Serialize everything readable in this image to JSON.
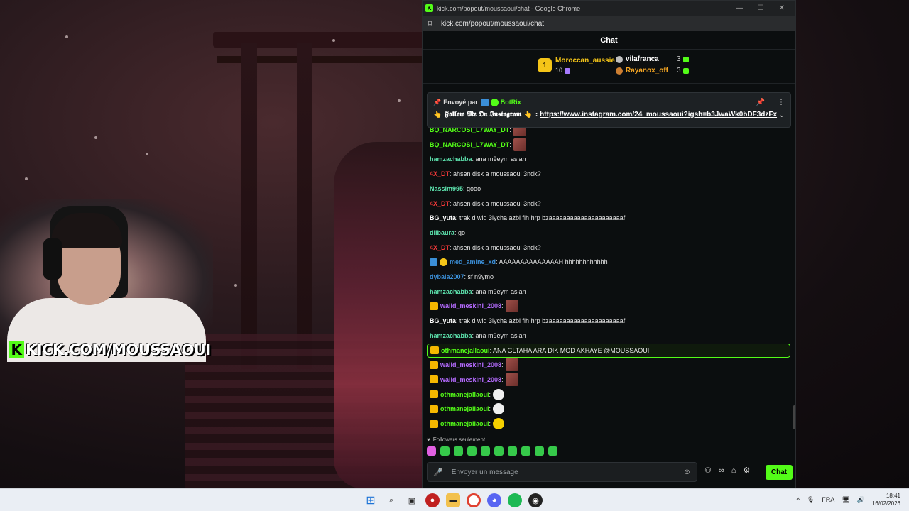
{
  "stream": {
    "overlay_brand": "KICK.COM/MOUSSAOUI",
    "overlay_logo_letter": "K"
  },
  "browser": {
    "window_title": "kick.com/popout/moussaoui/chat - Google Chrome",
    "url": "kick.com/popout/moussaoui/chat",
    "favicon_letter": "K"
  },
  "chat": {
    "header_title": "Chat",
    "leaderboard": {
      "first": {
        "rank": "1",
        "name": "Moroccan_aussie",
        "count": "10"
      },
      "others": [
        {
          "name": "vilafranca",
          "count": "3",
          "color": "#ffffff",
          "rank_color": "#c0c0c0"
        },
        {
          "name": "Rayanox_off",
          "count": "3",
          "color": "#f5a623",
          "rank_color": "#cd7f32"
        }
      ]
    },
    "pinned": {
      "label": "Envoyé par",
      "sender": "BotRix",
      "message_prefix": "👆 𝕱𝖔𝖑𝖑𝖔𝖜 𝕸𝖊 𝕺𝖓 𝕴𝖓𝖘𝖙𝖆𝖌𝖗𝖆𝖒 👆 :",
      "link": "https://www.instagram.com/24_moussaoui?igsh=b3JwaWk0bDF3dzFx"
    },
    "messages": [
      {
        "user": "BQ_NARCOSI_L7WAY_DT",
        "color": "#53fc18",
        "text": ":",
        "emote": "red"
      },
      {
        "user": "BQ_NARCOSI_L7WAY_DT",
        "color": "#53fc18",
        "text": ":",
        "emote": "red"
      },
      {
        "user": "hamzachabba",
        "color": "#5ee6b0",
        "text": ": ana m9eym aslan"
      },
      {
        "user": "4X_DT",
        "color": "#ff3b3b",
        "text": ": ahsen disk a moussaoui 3ndk?"
      },
      {
        "user": "Nassim995",
        "color": "#5ee6b0",
        "text": ": gooo"
      },
      {
        "user": "4X_DT",
        "color": "#ff3b3b",
        "text": ": ahsen disk a moussaoui 3ndk?"
      },
      {
        "user": "BG_yuta",
        "color": "#ffffff",
        "text": ": trak d wld 3iycha azbi fih hrp bzaaaaaaaaaaaaaaaaaaaaaf"
      },
      {
        "user": "diibaura",
        "color": "#5ee6b0",
        "text": ": go"
      },
      {
        "user": "4X_DT",
        "color": "#ff3b3b",
        "text": ": ahsen disk a moussaoui 3ndk?"
      },
      {
        "user": "med_amine_xd",
        "color": "#3b8fd8",
        "text": ": AAAAAAAAAAAAAAH hhhhhhhhhhhh",
        "badges": [
          "blue",
          "gold"
        ]
      },
      {
        "user": "dybala2007",
        "color": "#3b8fd8",
        "text": ": sf n9ymo"
      },
      {
        "user": "hamzachabba",
        "color": "#5ee6b0",
        "text": ": ana m9eym aslan"
      },
      {
        "user": "walid_meskini_2008",
        "color": "#b56bff",
        "text": ":",
        "emote": "red",
        "badges": [
          "crown"
        ]
      },
      {
        "user": "BG_yuta",
        "color": "#ffffff",
        "text": ": trak d wld 3iycha azbi fih hrp bzaaaaaaaaaaaaaaaaaaaaaf"
      },
      {
        "user": "hamzachabba",
        "color": "#5ee6b0",
        "text": ": ana m9eym aslan"
      },
      {
        "user": "othmanejallaoui",
        "color": "#53fc18",
        "text": ": ANA GLTAHA ARA DIK MOD AKHAYE @MOUSSAOUI",
        "badges": [
          "crown"
        ],
        "highlight": true
      },
      {
        "user": "walid_meskini_2008",
        "color": "#b56bff",
        "text": ":",
        "emote": "red",
        "badges": [
          "crown"
        ]
      },
      {
        "user": "walid_meskini_2008",
        "color": "#b56bff",
        "text": ":",
        "emote": "red",
        "badges": [
          "crown"
        ]
      },
      {
        "user": "othmanejallaoui",
        "color": "#53fc18",
        "text": ":",
        "emote": "white",
        "badges": [
          "crown"
        ]
      },
      {
        "user": "othmanejallaoui",
        "color": "#53fc18",
        "text": ":",
        "emote": "white",
        "badges": [
          "crown"
        ]
      },
      {
        "user": "othmanejallaoui",
        "color": "#53fc18",
        "text": ":",
        "emote": "yellow",
        "badges": [
          "crown"
        ]
      }
    ],
    "followers_only_label": "Followers seulement",
    "input": {
      "placeholder": "Envoyer un message"
    },
    "send_label": "Chat"
  },
  "taskbar": {
    "language": "FRA",
    "time": "18:41",
    "date": "16/02/2026"
  }
}
